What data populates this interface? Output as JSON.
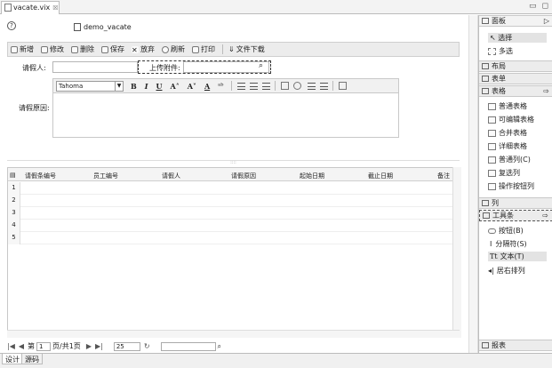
{
  "editor_tab": {
    "title": "vacate.vix",
    "close_glyph": "☒"
  },
  "window_buttons": {
    "minimize": "▭",
    "maximize": "◻"
  },
  "form": {
    "name": "demo_vacate"
  },
  "toolbar": {
    "items": [
      {
        "label": "新增",
        "icon": "add-icon"
      },
      {
        "label": "修改",
        "icon": "edit-icon"
      },
      {
        "label": "删除",
        "icon": "delete-icon"
      },
      {
        "label": "保存",
        "icon": "save-icon"
      },
      {
        "label": "放弃",
        "icon": "discard-icon"
      },
      {
        "label": "刷新",
        "icon": "refresh-icon"
      },
      {
        "label": "打印",
        "icon": "print-icon"
      },
      {
        "label": "文件下载",
        "icon": "download-icon"
      }
    ]
  },
  "fields": {
    "applicant_label": "请假人:",
    "attachment_label": "上传附件:",
    "reason_label": "请假原因:"
  },
  "editor": {
    "font": "Tahoma",
    "bold": "B",
    "italic": "I",
    "underline": "U",
    "grow": "A˄",
    "shrink": "A˅",
    "color": "A",
    "highlight": "ᵃᵇ"
  },
  "splitter_label": "::::",
  "grid": {
    "columns": [
      "请假条编号",
      "员工编号",
      "请假人",
      "请假原因",
      "起始日期",
      "截止日期",
      "备注"
    ],
    "rows": [
      "1",
      "2",
      "3",
      "4",
      "5"
    ]
  },
  "pager": {
    "first": "|◀",
    "prev": "◀",
    "page_prefix": "第",
    "page_value": "1",
    "page_suffix": "页/共1页",
    "next": "▶",
    "last": "▶|",
    "page_size": "25"
  },
  "bottom_tabs": {
    "design": "设计",
    "source": "源码"
  },
  "palette": {
    "header": "面板",
    "tools": [
      {
        "label": "选择",
        "selected": true
      },
      {
        "label": "多选",
        "selected": false
      }
    ],
    "drawers": {
      "layout": "布局",
      "form": "表单",
      "table": "表格",
      "column": "列",
      "toolbar": "工具条",
      "report": "报表"
    },
    "table_items": [
      "普通表格",
      "可编辑表格",
      "合并表格",
      "详细表格",
      "普通列(C)",
      "复选列",
      "操作按钮列"
    ],
    "toolbar_items": [
      "按钮(B)",
      "分隔符(S)",
      "文本(T)",
      "居右排列"
    ]
  }
}
